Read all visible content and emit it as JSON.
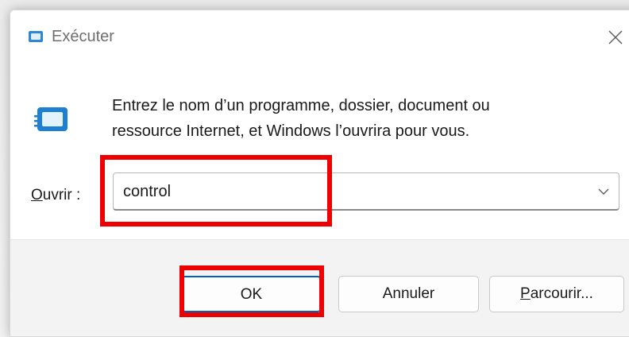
{
  "window": {
    "title": "Exécuter",
    "close_icon": "close-icon"
  },
  "content": {
    "message_line1": "Entrez le nom d’un programme, dossier, document ou",
    "message_line2": "ressource Internet, et Windows l’ouvrira pour vous.",
    "open_label_accel": "O",
    "open_label_rest": "uvrir :",
    "input_value": "control"
  },
  "buttons": {
    "ok": "OK",
    "cancel": "Annuler",
    "browse_accel": "P",
    "browse_rest": "arcourir..."
  },
  "colors": {
    "highlight": "#ee0000",
    "accent": "#005fb8",
    "icon_blue": "#2b88d8"
  },
  "icons": [
    "run-icon",
    "run-large-icon",
    "close-icon",
    "chevron-down-icon"
  ]
}
